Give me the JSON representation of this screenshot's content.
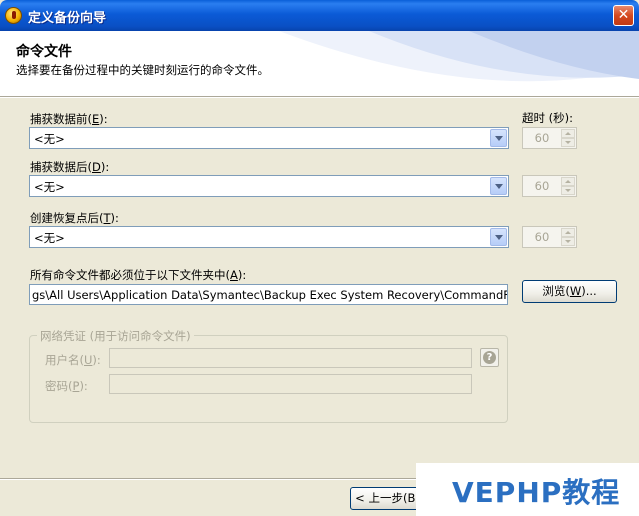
{
  "window": {
    "title": "定义备份向导",
    "close_glyph": "✕"
  },
  "header": {
    "title": "命令文件",
    "subtitle": "选择要在备份过程中的关键时刻运行的命令文件。"
  },
  "timeout_label": "超时 (秒):",
  "before_capture": {
    "label": "捕获数据前",
    "key": "E",
    "selected": "<无>",
    "timeout": "60"
  },
  "after_capture": {
    "label": "捕获数据后",
    "key": "D",
    "selected": "<无>",
    "timeout": "60"
  },
  "after_restore_point": {
    "label": "创建恢复点后",
    "key": "T",
    "selected": "<无>",
    "timeout": "60"
  },
  "folder": {
    "label": "所有命令文件都必须位于以下文件夹中",
    "key": "A",
    "path": "gs\\All Users\\Application Data\\Symantec\\Backup Exec System Recovery\\CommandFiles\\",
    "browse_label": "浏览",
    "browse_key": "W",
    "browse_suffix": "..."
  },
  "credentials": {
    "legend": "网络凭证 (用于访问命令文件)",
    "username_label": "用户名",
    "username_key": "U",
    "password_label": "密码",
    "password_key": "P",
    "help_glyph": "?"
  },
  "footer": {
    "back_label": "< 上一步(B)"
  },
  "watermark": {
    "text": "VEPHP教程"
  },
  "colors": {
    "title_bar": "#0a5fd8",
    "window_bg": "#ece9d8",
    "disabled_text": "#a8a595",
    "watermark": "#2b6fc1"
  },
  "icons": {
    "app": "backup-exec-icon",
    "close": "close-icon",
    "help": "help-icon",
    "dropdown": "chevron-down-icon"
  }
}
